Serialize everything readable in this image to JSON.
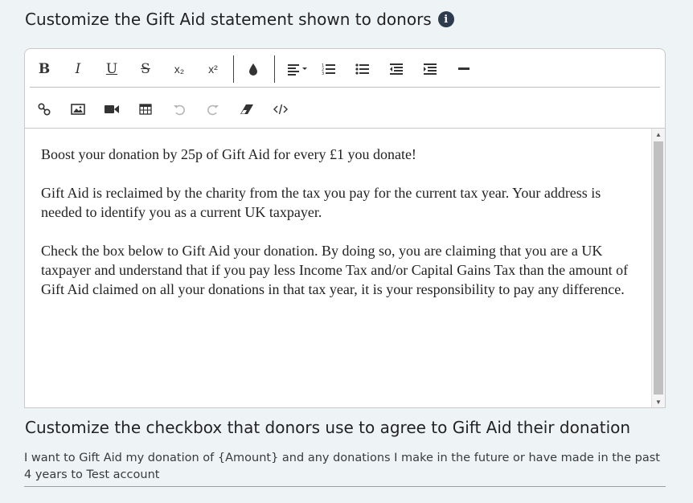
{
  "statement_section": {
    "heading": "Customize the Gift Aid statement shown to donors",
    "info_icon_glyph": "i"
  },
  "toolbar": {
    "bold": "B",
    "italic": "I",
    "underline": "U",
    "strike": "S",
    "subscript": "x₂",
    "superscript": "x²",
    "icons_row1": [
      "bold-icon",
      "italic-icon",
      "underline-icon",
      "strikethrough-icon",
      "subscript-icon",
      "superscript-icon",
      "color-icon",
      "align-icon",
      "ordered-list-icon",
      "unordered-list-icon",
      "outdent-icon",
      "indent-icon",
      "horizontal-rule-icon"
    ],
    "icons_row2": [
      "link-icon",
      "image-icon",
      "video-icon",
      "table-icon",
      "undo-icon",
      "redo-icon",
      "clear-format-icon",
      "code-view-icon"
    ]
  },
  "editor": {
    "paragraphs": [
      "Boost your donation by 25p of Gift Aid for every £1 you donate!",
      "Gift Aid is reclaimed by the charity from the tax you pay for the current tax year. Your address is needed to identify you as a current UK taxpayer.",
      "Check the box below to Gift Aid your donation. By doing so, you are claiming that you are a UK taxpayer and understand that if you pay less Income Tax and/or Capital Gains Tax than the amount of Gift Aid claimed on all your donations in that tax year, it is your responsibility to pay any difference."
    ]
  },
  "checkbox_section": {
    "heading": "Customize the checkbox that donors use to agree to Gift Aid their donation",
    "value": "I want to Gift Aid my donation of {Amount} and any donations I make in the future or have made in the past 4 years to Test account"
  },
  "colors": {
    "page_bg": "#eef4f6",
    "info_icon_bg": "#2e3a4d",
    "scroll_thumb": "#c0c0c0"
  }
}
